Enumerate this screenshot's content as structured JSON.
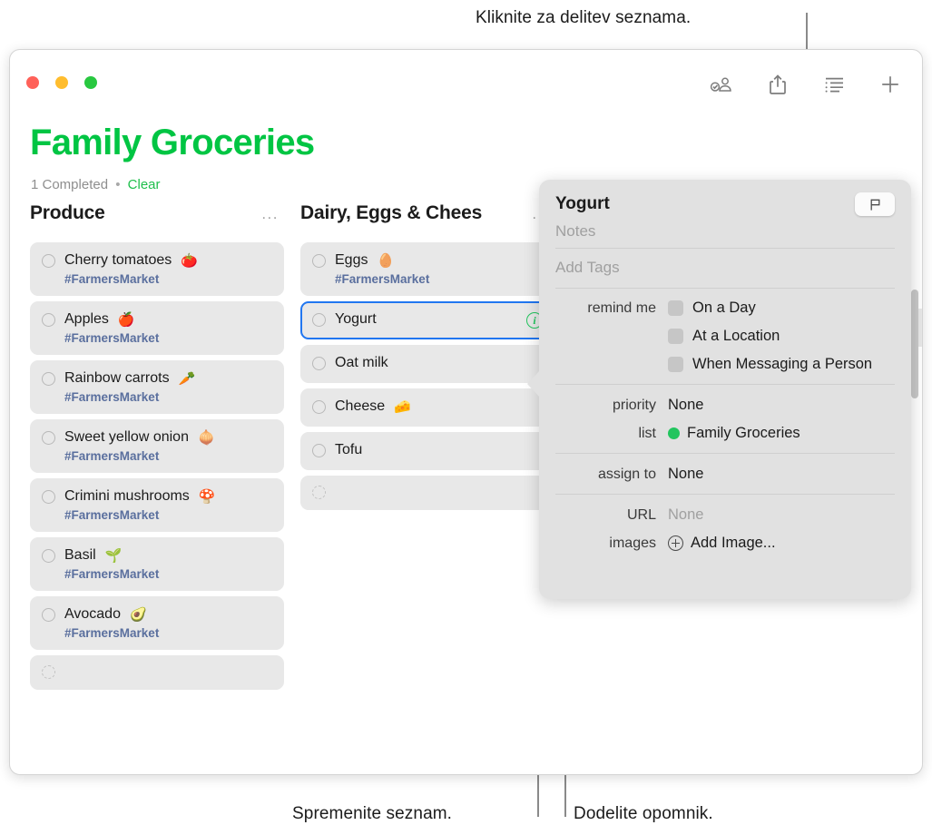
{
  "callouts": {
    "top": "Kliknite za delitev seznama.",
    "bottom_left": "Spremenite seznam.",
    "bottom_right": "Dodelite opomnik."
  },
  "window": {
    "traffic_lights": [
      "close",
      "minimize",
      "zoom"
    ],
    "toolbar": [
      {
        "name": "shared-with-you-icon",
        "label": "Shared"
      },
      {
        "name": "share-icon",
        "label": "Share"
      },
      {
        "name": "list-view-icon",
        "label": "View Options"
      },
      {
        "name": "add-icon",
        "label": "New Reminder"
      }
    ]
  },
  "list": {
    "title": "Family Groceries",
    "completed_text": "1 Completed",
    "separator": "•",
    "clear_label": "Clear",
    "accent_color": "#00c543"
  },
  "columns": [
    {
      "title": "Produce",
      "more_label": "...",
      "items": [
        {
          "text": "Cherry tomatoes",
          "emoji": "🍅",
          "tag": "#FarmersMarket"
        },
        {
          "text": "Apples",
          "emoji": "🍎",
          "tag": "#FarmersMarket"
        },
        {
          "text": "Rainbow carrots",
          "emoji": "🥕",
          "tag": "#FarmersMarket"
        },
        {
          "text": "Sweet yellow onion",
          "emoji": "🧅",
          "tag": "#FarmersMarket"
        },
        {
          "text": "Crimini mushrooms",
          "emoji": "🍄",
          "tag": "#FarmersMarket"
        },
        {
          "text": "Basil",
          "emoji": "🌱",
          "tag": "#FarmersMarket"
        },
        {
          "text": "Avocado",
          "emoji": "🥑",
          "tag": "#FarmersMarket"
        },
        {
          "text": "",
          "emoji": "",
          "tag": "",
          "placeholder": true
        }
      ]
    },
    {
      "title": "Dairy, Eggs & Chees",
      "more_label": "...",
      "items": [
        {
          "text": "Eggs",
          "emoji": "🥚",
          "tag": "#FarmersMarket"
        },
        {
          "text": "Yogurt",
          "emoji": "",
          "tag": "",
          "selected": true,
          "info_badge": "i"
        },
        {
          "text": "Oat milk",
          "emoji": "",
          "tag": ""
        },
        {
          "text": "Cheese",
          "emoji": "🧀",
          "tag": ""
        },
        {
          "text": "Tofu",
          "emoji": "",
          "tag": ""
        },
        {
          "text": "",
          "emoji": "",
          "tag": "",
          "placeholder": true
        }
      ]
    }
  ],
  "popover": {
    "title": "Yogurt",
    "flag_icon": "flag-icon",
    "notes_placeholder": "Notes",
    "tags_placeholder": "Add Tags",
    "remind_me_label": "remind me",
    "remind_options": [
      {
        "label": "On a Day",
        "checked": false
      },
      {
        "label": "At a Location",
        "checked": false
      },
      {
        "label": "When Messaging a Person",
        "checked": false
      }
    ],
    "priority_label": "priority",
    "priority_value": "None",
    "list_label": "list",
    "list_value": "Family Groceries",
    "list_color": "#22c55e",
    "assign_label": "assign to",
    "assign_value": "None",
    "url_label": "URL",
    "url_value": "None",
    "images_label": "images",
    "images_value": "Add Image..."
  }
}
